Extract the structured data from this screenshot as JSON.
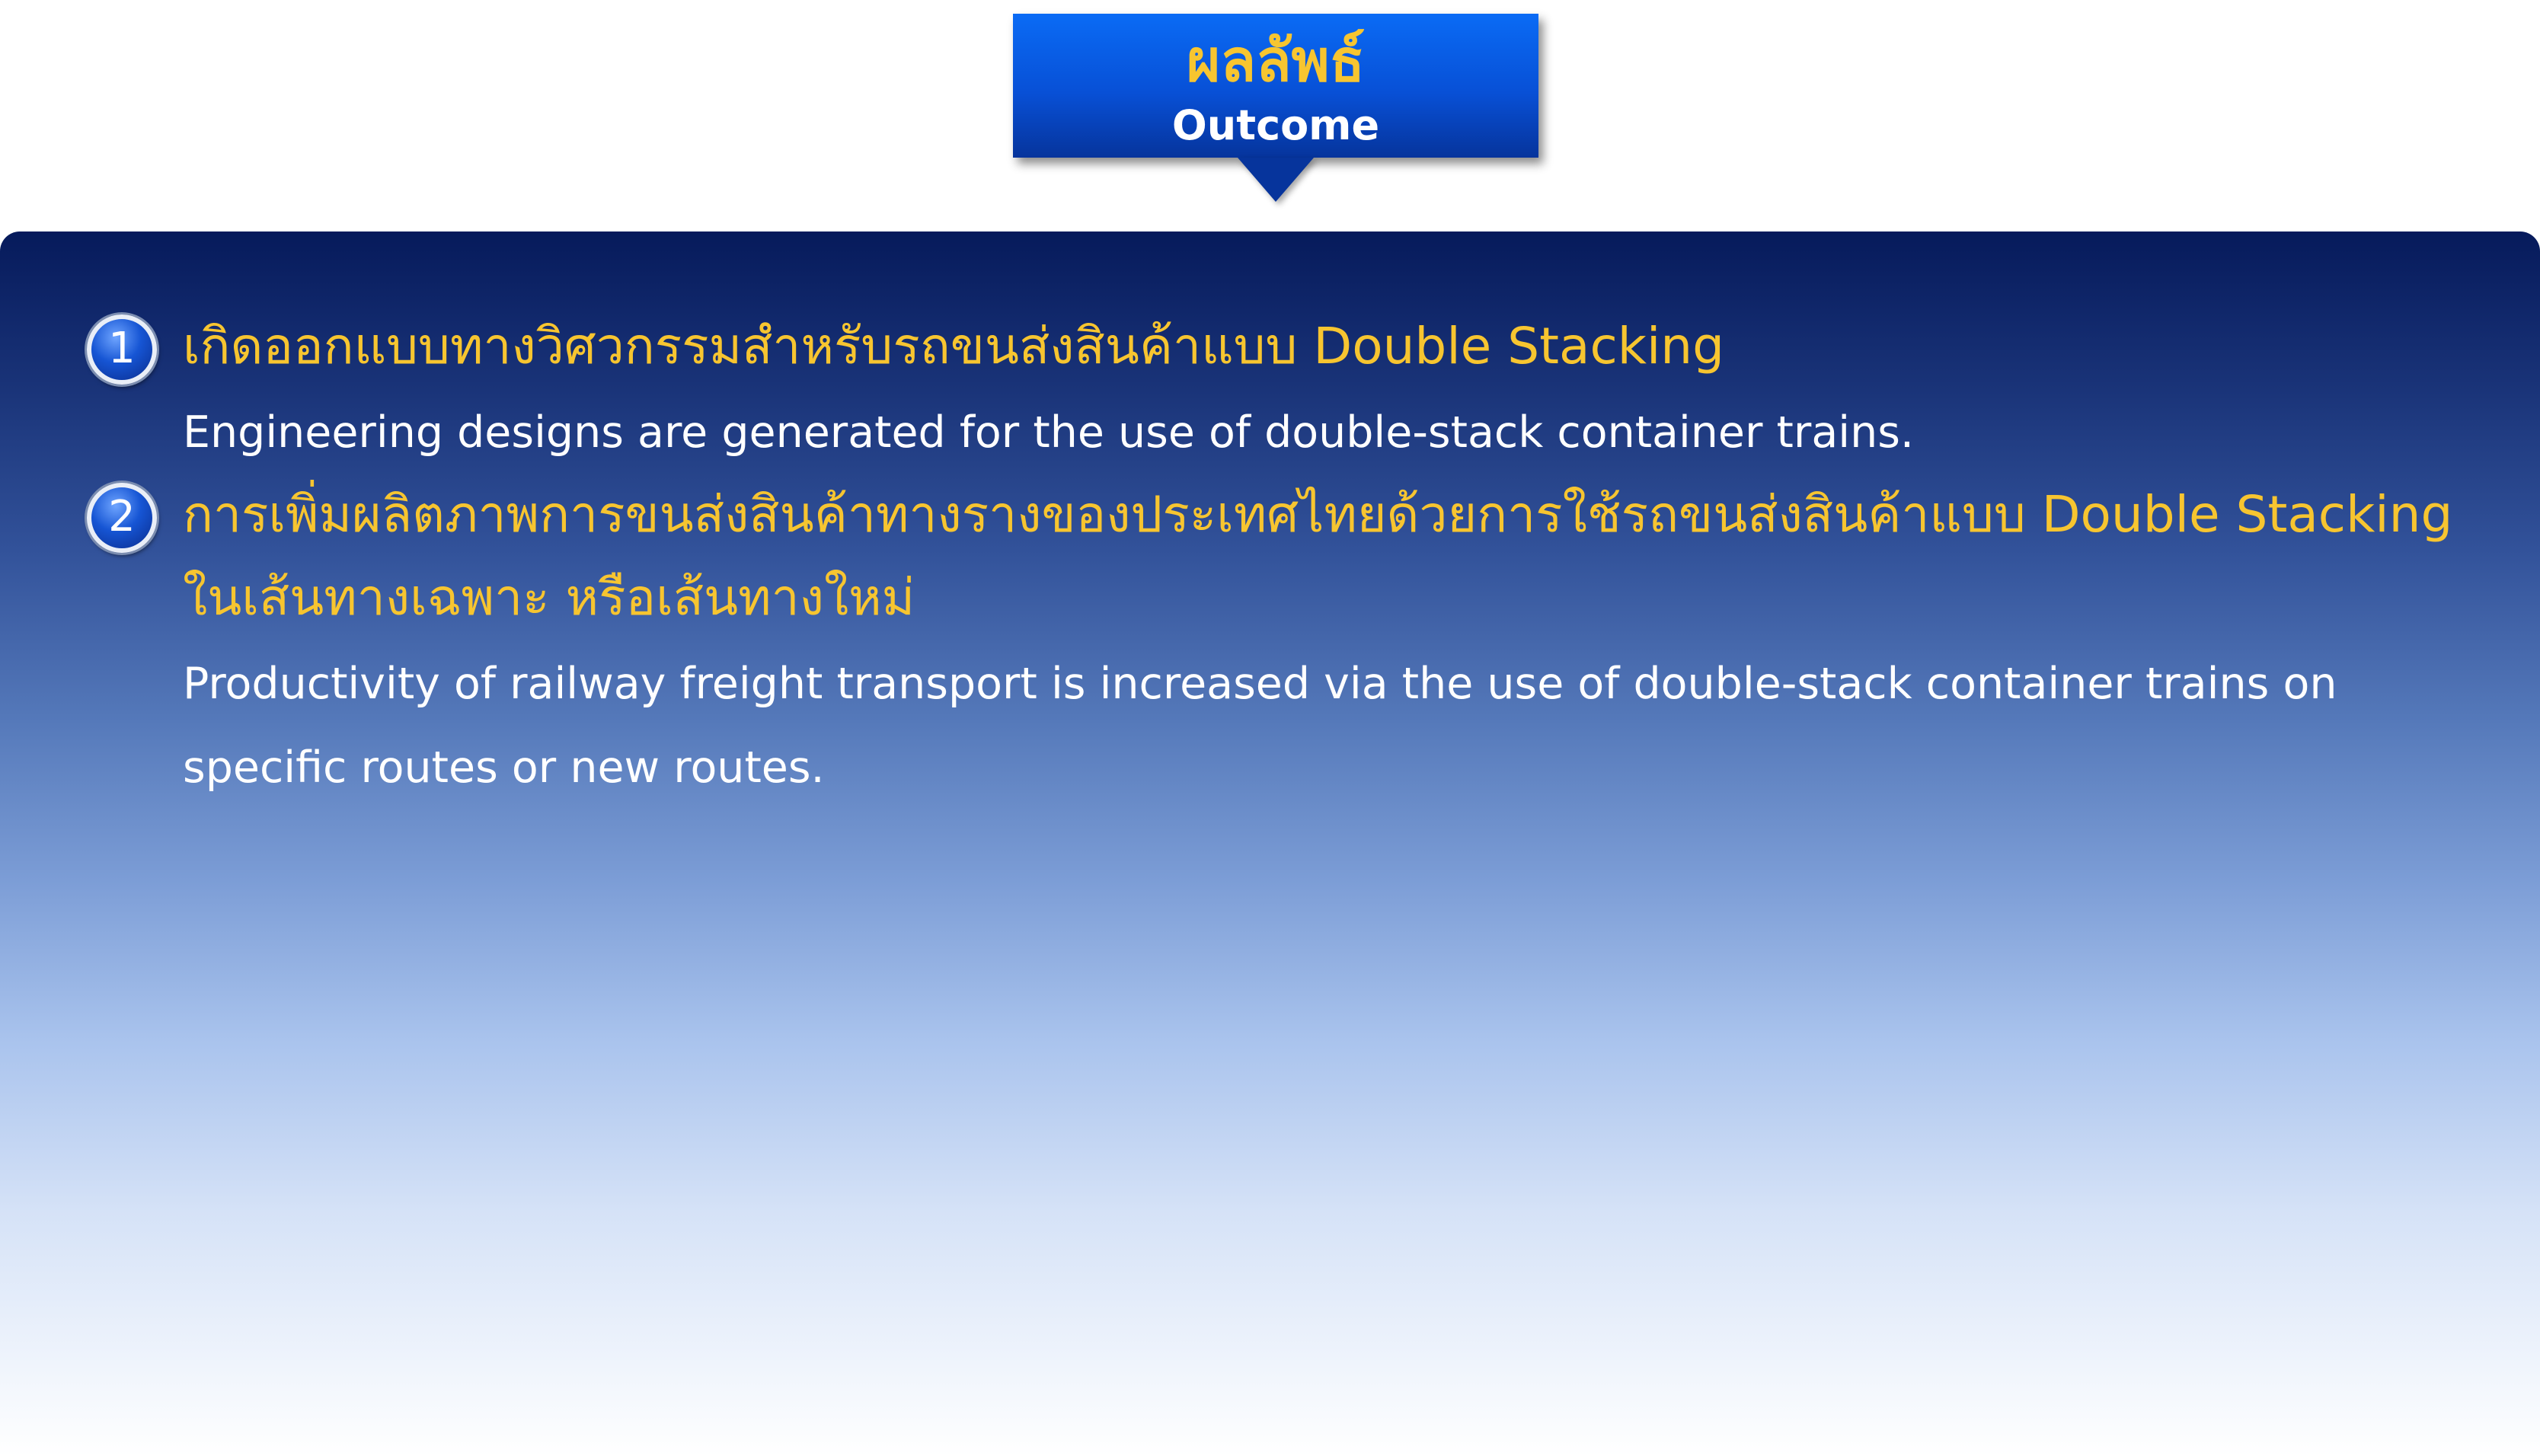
{
  "header": {
    "title_th": "ผลลัพธ์",
    "title_en": "Outcome"
  },
  "items": [
    {
      "number": "1",
      "th_lines": [
        "เกิดออกแบบทางวิศวกรรมสำหรับรถขนส่งสินค้าแบบ Double Stacking"
      ],
      "en_lines": [
        "Engineering designs are generated for the use of double-stack container trains."
      ]
    },
    {
      "number": "2",
      "th_lines": [
        "การเพิ่มผลิตภาพการขนส่งสินค้าทางรางของประเทศไทยด้วยการใช้รถขนส่งสินค้าแบบ Double Stacking",
        "ในเส้นทางเฉพาะ หรือเส้นทางใหม่"
      ],
      "en_lines": [
        "Productivity of railway freight transport is increased via the use of double-stack container trains on",
        "specific routes or new routes."
      ]
    }
  ],
  "colors": {
    "accent_yellow": "#f7c530",
    "panel_top": "#061a5b",
    "title_blue": "#0a6bf5"
  }
}
